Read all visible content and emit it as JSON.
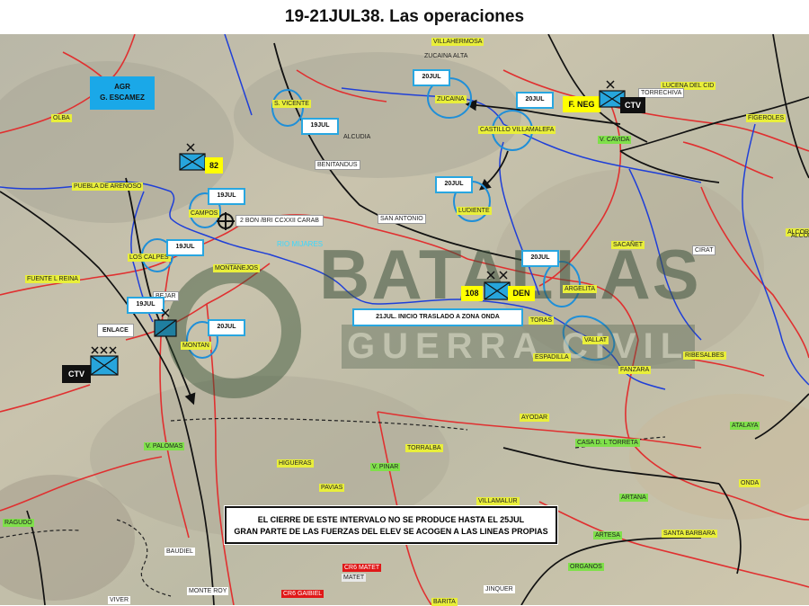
{
  "title": "19-21JUL38. Las operaciones",
  "watermark": {
    "line1": "BATALLAS",
    "line2": "GUERRA CIVIL"
  },
  "river": "RIO MIJARES",
  "towns_yellow": [
    "OLBA",
    "PUEBLA DE ARENOSO",
    "CAMPOS",
    "LOS CALPES",
    "MONTANEJOS",
    "MONTAN",
    "S. VICENTE",
    "ZUCAINA",
    "CASTILLO VILLAMALEFA",
    "LUDIENTE",
    "ARGELITA",
    "TORAS",
    "VALLAT",
    "ESPADILLA",
    "FANZARA",
    "LUCENA DEL CID",
    "FIGEROLES",
    "ALCORA",
    "RIBESALBES",
    "ONDA",
    "HIGUERAS",
    "PAVIAS",
    "TORRALBA",
    "AYODAR",
    "FUENTE L REINA",
    "VILLAMALUR",
    "SANTA BARBARA",
    "VILLAHERMOSA",
    "SACAÑET"
  ],
  "towns_green": [
    "V. PINAR",
    "RAGUDO",
    "ATALAYA",
    "V. PALOMAS",
    "ARTANA",
    "ORGANOS",
    "V. CAVIDA",
    "ARTESA",
    "CASA D. L TORRETA"
  ],
  "towns_white": [
    "BEJAR",
    "BENITANDUS",
    "SAN ANTONIO",
    "TORRECHIVA",
    "CIRAT"
  ],
  "towns_red": [
    "CR6 MATET",
    "CR6 GAIBIEL"
  ],
  "towns_plain": [
    "ALCOR",
    "ALCUDIA",
    "MONTE ROY",
    "MATET",
    "VIVER",
    "BARITA",
    "JINQUER",
    "ZUCAINA ALTA",
    "BAUDIEL"
  ],
  "dates": [
    "20JUL",
    "20JUL",
    "19JUL",
    "20JUL",
    "19JUL",
    "19JUL",
    "19JUL",
    "20JUL",
    "20JUL"
  ],
  "units": {
    "agr": {
      "line1": "AGR",
      "line2": "G. ESCAMEZ"
    },
    "u82": "82",
    "u108": "108",
    "den": "DEN",
    "fneg": "F. NEG",
    "ctv_right": "CTV",
    "ctv_left": "CTV",
    "enlace": "ENLACE",
    "bon": "2 BON /BRI CCXXII CARAB",
    "traslado": "21JUL. INICIO TRASLADO A ZONA ONDA"
  },
  "note": {
    "line1": "EL CIERRE DE ESTE INTERVALO NO SE PRODUCE HASTA EL 25JUL",
    "line2": "GRAN PARTE DE LAS FUERZAS DEL ELEV SE ACOGEN A LAS LINEAS PROPIAS"
  },
  "colors": {
    "road": "#e03030",
    "river": "#1f3fd8",
    "front": "#111111",
    "accent": "#28a6e0",
    "unit": "#27a5dc"
  }
}
